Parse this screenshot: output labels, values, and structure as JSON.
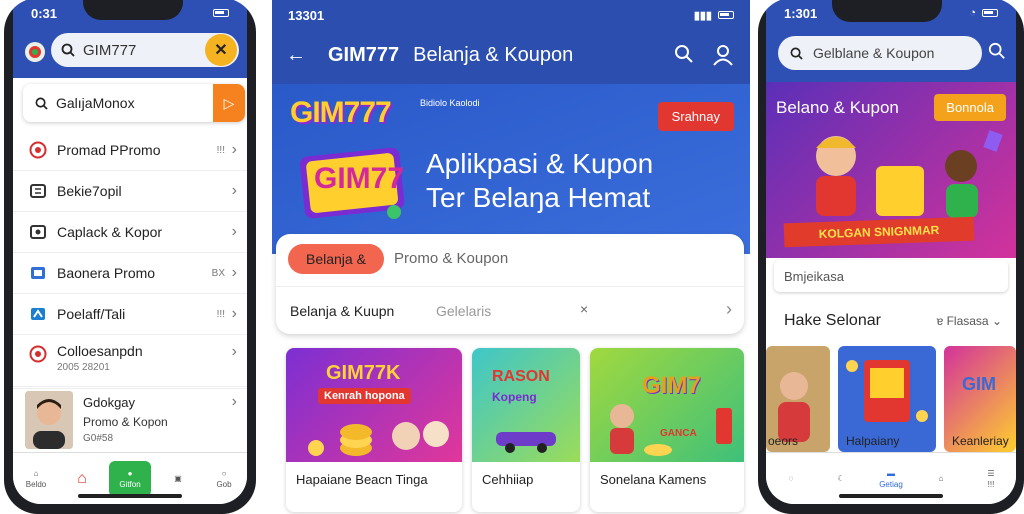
{
  "phone_left": {
    "time": "0:31",
    "search_value": "GIM777",
    "sub_search_value": "GalıjaMonox",
    "menu": [
      {
        "label": "Promad PPromo",
        "suffix": "!!!"
      },
      {
        "label": "Bekie7opil",
        "suffix": ""
      },
      {
        "label": "Caplack & Kopor",
        "suffix": ""
      },
      {
        "label": "Baonera Promo",
        "suffix": "BX"
      },
      {
        "label": "Poelaff/Tali",
        "suffix": "!!!"
      },
      {
        "label": "Colloesanpdn",
        "suffix": ""
      }
    ],
    "menu_sub": "2005 28201",
    "card": {
      "title": "Gdokgay",
      "subtitle": "Promo & Kopon",
      "extra": "G0#58"
    },
    "tabs": [
      "Beldo",
      "",
      "Gitfon",
      "",
      "Gob"
    ]
  },
  "app_center": {
    "time": "13301",
    "title_brand": "GIM777",
    "title_text": "Belanja & Koupon",
    "banner": {
      "logo": "GIM777",
      "small_text": "Bidiolo Kaolodi",
      "badge": "Srahnay",
      "headline_1": "Aplikpasi & Kupon",
      "headline_2": "Ter Belaŋa Hemat",
      "big_mark": "GIM77"
    },
    "tab_active": "Belanja &",
    "tab_inactive": "Promo & Koupon",
    "row": {
      "left": "Belanja & Kuupn",
      "mid": "Gelelaris",
      "close": "×"
    },
    "cards": [
      {
        "img_title": "GIM77K",
        "img_sub": "Kenrah hopona",
        "caption": "Hapaiane Beacn Tinga"
      },
      {
        "img_title": "RASON",
        "img_sub": "Kopeng",
        "caption": "Cehhiiap"
      },
      {
        "img_title": "GIM7",
        "img_sub": "GANCA",
        "caption": "Sonelana Kamens"
      }
    ],
    "colors": {
      "header": "#2b4eaf",
      "accent_red": "#e23631",
      "pill": "#f2654f"
    }
  },
  "phone_right": {
    "time": "1:301",
    "search_value": "Gelblane & Koupon",
    "banner_title": "Belano & Kupon",
    "banner_button": "Bonnola",
    "ribbon": "KOLGAN SNIGNMAR",
    "input_value": "Bmjeikasa",
    "section_title": "Hake Selonar",
    "filter_label": "ɐ Flasasa",
    "cards": [
      {
        "caption": "oeors",
        "title": ""
      },
      {
        "caption": "Halpaiany",
        "title": ""
      },
      {
        "caption": "Keanleriay",
        "title": "GIM"
      }
    ],
    "tabs": [
      "",
      "",
      "Getiag",
      "",
      "!!!"
    ]
  }
}
